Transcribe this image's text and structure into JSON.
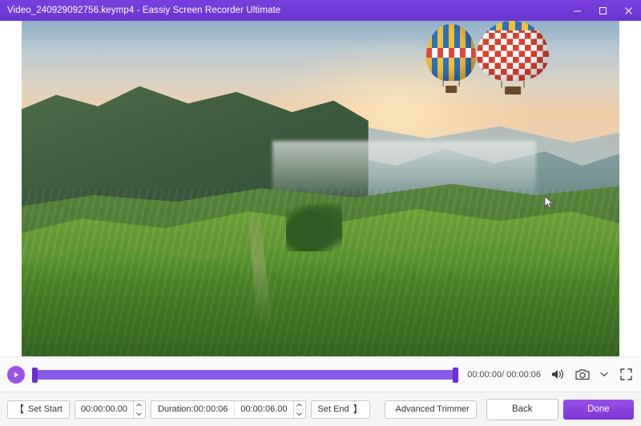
{
  "window": {
    "title": "Video_240929092756.keymp4  -  Eassiy Screen Recorder Ultimate",
    "controls": {
      "minimize": "minimize-icon",
      "maximize": "maximize-icon",
      "close": "close-icon"
    },
    "accent_color": "#6d3bd6"
  },
  "video": {
    "cursor_icon": "mouse-pointer-icon",
    "scene_alt": "Aerial view of green tea plantation hills at sunrise with two hot air balloons in the sky"
  },
  "playback": {
    "play_icon": "play-icon",
    "time_display": "00:00:00/ 00:00:06",
    "volume_icon": "speaker-icon",
    "snapshot_icon": "camera-icon",
    "more_icon": "chevron-down-icon",
    "fullscreen_icon": "fullscreen-icon",
    "progress_percent": 0,
    "trim_start_percent": 0,
    "trim_end_percent": 100
  },
  "toolbar": {
    "set_start_label": "Set Start",
    "set_start_icon": "trim-start-icon",
    "start_time_value": "00:00:00.00",
    "duration_label": "Duration:00:00:06",
    "duration_value": "00:00:06.00",
    "set_end_label": "Set End",
    "set_end_icon": "trim-end-icon",
    "advanced_trimmer_label": "Advanced Trimmer",
    "advanced_trimmer_icon": "scissors-icon",
    "back_label": "Back",
    "done_label": "Done",
    "bracket_open": "【",
    "bracket_close": "】",
    "spinner_up_icon": "caret-up-icon",
    "spinner_down_icon": "caret-down-icon"
  }
}
